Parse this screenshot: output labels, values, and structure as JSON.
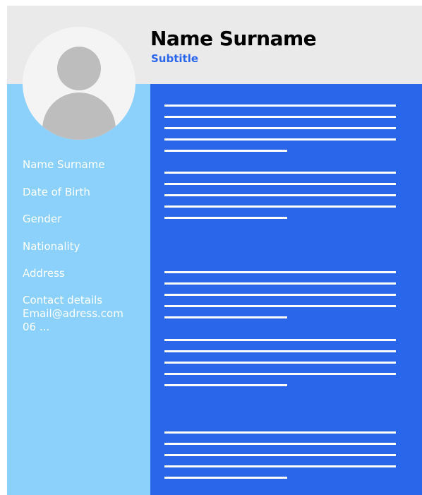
{
  "header": {
    "name": "Name Surname",
    "subtitle": "Subtitle"
  },
  "avatar": {
    "icon": "user-placeholder-icon"
  },
  "sidebar": {
    "fields": [
      "Name Surname",
      "Date of Birth",
      "Gender",
      "Nationality",
      "Address"
    ],
    "contact": {
      "label": "Contact details",
      "email": "Email@adress.com",
      "phone": "06 ..."
    }
  },
  "colors": {
    "header_bg": "#eaeaea",
    "sidebar_bg": "#8cd1fb",
    "main_bg": "#2a66ea",
    "subtitle": "#2a66ea",
    "placeholder_lines": "#ffffff"
  },
  "content_blocks": [
    {
      "full_lines": 4,
      "short_lines": 1
    },
    {
      "full_lines": 4,
      "short_lines": 1
    },
    {
      "full_lines": 4,
      "short_lines": 1
    },
    {
      "full_lines": 4,
      "short_lines": 1
    },
    {
      "full_lines": 4,
      "short_lines": 1
    }
  ]
}
